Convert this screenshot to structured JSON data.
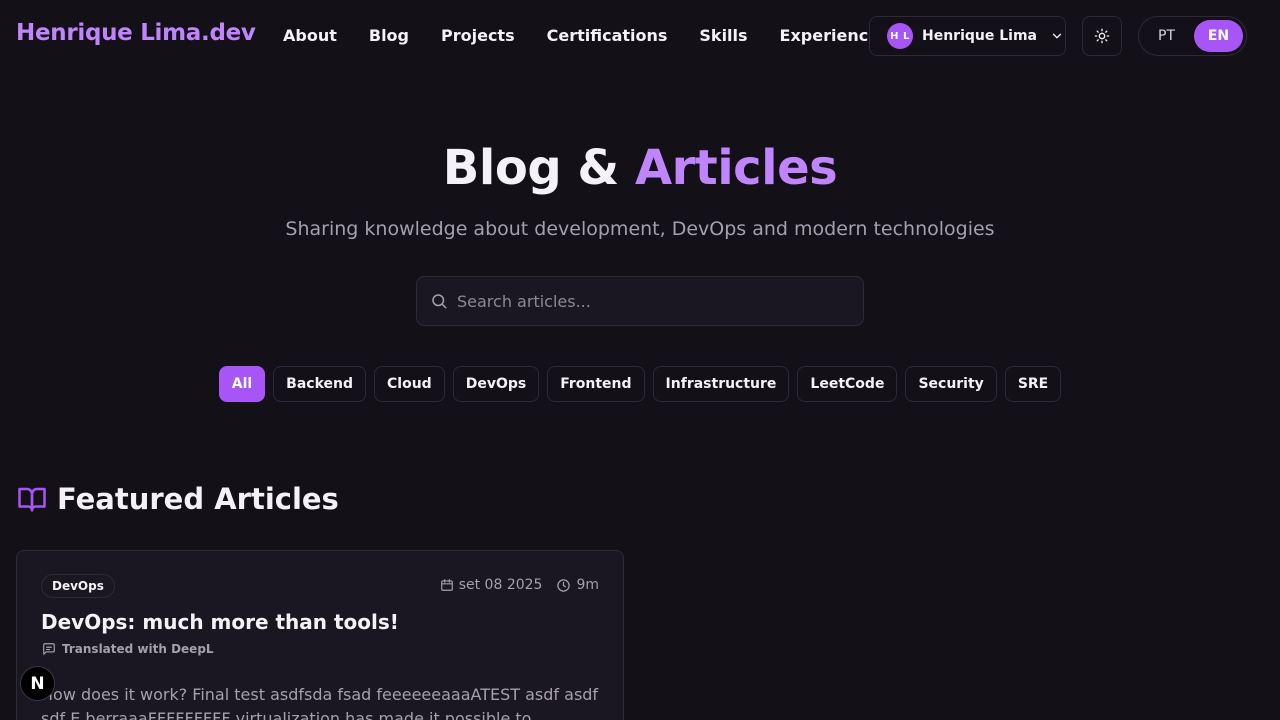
{
  "header": {
    "brand": "Henrique Lima.dev",
    "nav": [
      "About",
      "Blog",
      "Projects",
      "Certifications",
      "Skills",
      "Experience"
    ],
    "user": {
      "initials": "H L",
      "name": "Henrique Lima"
    },
    "languages": {
      "pt": "PT",
      "en": "EN",
      "active": "EN"
    }
  },
  "hero": {
    "title_main": "Blog & ",
    "title_accent": "Articles",
    "subtitle": "Sharing knowledge about development, DevOps and modern technologies"
  },
  "search": {
    "placeholder": "Search articles..."
  },
  "filters": {
    "items": [
      "All",
      "Backend",
      "Cloud",
      "DevOps",
      "Frontend",
      "Infrastructure",
      "LeetCode",
      "Security",
      "SRE"
    ],
    "active": "All"
  },
  "featured": {
    "heading": "Featured Articles",
    "article": {
      "tag": "DevOps",
      "date": "set 08 2025",
      "read_time": "9m",
      "title": "DevOps: much more than tools!",
      "translation_note": "Translated with DeepL",
      "excerpt": "How does it work? Final test asdfsda fsad feeeeeeaaaATEST asdf asdf sdf E berraaaFFFFFFFFF virtualization has made it possible to abstract asfas f"
    }
  },
  "dev_badge": "N",
  "colors": {
    "accent": "#a855f7",
    "accent_text": "#c084fc",
    "background": "#131017"
  }
}
